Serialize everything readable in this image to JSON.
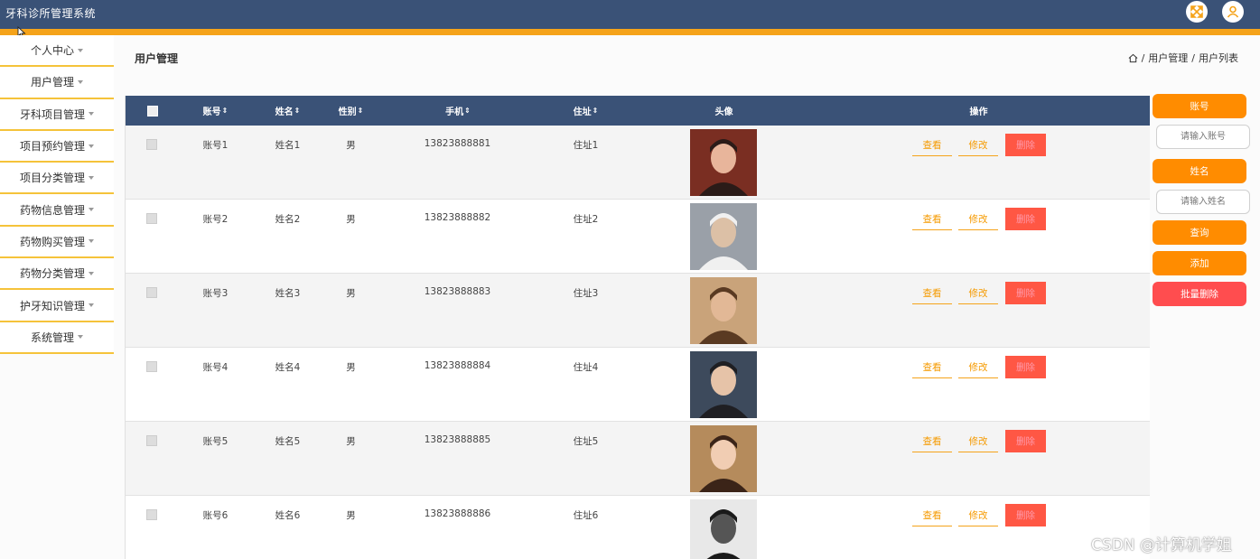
{
  "app": {
    "title": "牙科诊所管理系统"
  },
  "header_icons": [
    "fullscreen-icon",
    "user-icon"
  ],
  "sidebar": {
    "items": [
      {
        "label": "个人中心"
      },
      {
        "label": "用户管理"
      },
      {
        "label": "牙科项目管理"
      },
      {
        "label": "项目预约管理"
      },
      {
        "label": "项目分类管理"
      },
      {
        "label": "药物信息管理"
      },
      {
        "label": "药物购买管理"
      },
      {
        "label": "药物分类管理"
      },
      {
        "label": "护牙知识管理"
      },
      {
        "label": "系统管理"
      }
    ]
  },
  "page": {
    "title": "用户管理",
    "breadcrumb": [
      "用户管理",
      "用户列表"
    ],
    "breadcrumb_sep": "/"
  },
  "table": {
    "columns": {
      "account": "账号",
      "name": "姓名",
      "gender": "性别",
      "phone": "手机",
      "address": "住址",
      "avatar": "头像",
      "actions": "操作"
    },
    "sort_glyph": "⇕",
    "actions": {
      "view": "查看",
      "edit": "修改",
      "delete": "删除"
    },
    "rows": [
      {
        "account": "账号1",
        "name": "姓名1",
        "gender": "男",
        "phone": "13823888881",
        "address": "住址1"
      },
      {
        "account": "账号2",
        "name": "姓名2",
        "gender": "男",
        "phone": "13823888882",
        "address": "住址2"
      },
      {
        "account": "账号3",
        "name": "姓名3",
        "gender": "男",
        "phone": "13823888883",
        "address": "住址3"
      },
      {
        "account": "账号4",
        "name": "姓名4",
        "gender": "男",
        "phone": "13823888884",
        "address": "住址4"
      },
      {
        "account": "账号5",
        "name": "姓名5",
        "gender": "男",
        "phone": "13823888885",
        "address": "住址5"
      },
      {
        "account": "账号6",
        "name": "姓名6",
        "gender": "男",
        "phone": "13823888886",
        "address": "住址6"
      }
    ]
  },
  "search": {
    "account_label": "账号",
    "account_placeholder": "请输入账号",
    "name_label": "姓名",
    "name_placeholder": "请输入姓名",
    "query_button": "查询",
    "add_button": "添加",
    "batch_delete_button": "批量删除"
  },
  "watermark": "CSDN @计算机学姐",
  "colors": {
    "header": "#3a5277",
    "accent": "#f5a31a",
    "button": "#ff8c00",
    "danger": "#ff4d4f"
  }
}
